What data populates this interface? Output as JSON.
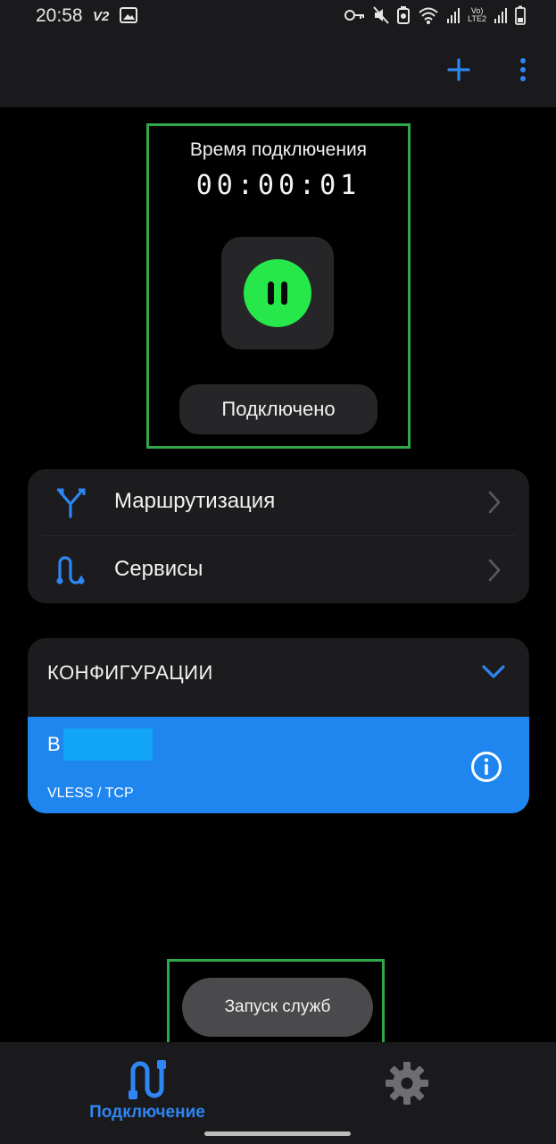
{
  "status_bar": {
    "time": "20:58",
    "app_badge": "V2",
    "network_label_top": "Vo)",
    "network_label_bottom": "LTE2"
  },
  "toolbar": {
    "add_icon": "plus-icon",
    "more_icon": "more-vertical-icon"
  },
  "connection": {
    "title": "Время подключения",
    "timer": "00:00:01",
    "state_label": "Подключено",
    "button_icon": "pause-icon",
    "button_color": "#27e84a"
  },
  "menu": {
    "items": [
      {
        "label": "Маршрутизация",
        "icon": "routing-icon"
      },
      {
        "label": "Сервисы",
        "icon": "services-icon"
      }
    ]
  },
  "configs": {
    "title": "КОНФИГУРАЦИИ",
    "items": [
      {
        "name": "B",
        "protocol": "VLESS / TCP",
        "selected": true
      }
    ]
  },
  "toast": {
    "text": "Запуск служб"
  },
  "bottom_nav": {
    "connect_label": "Подключение",
    "settings_icon": "gear-icon"
  },
  "colors": {
    "accent": "#2e86f2",
    "connected": "#27e84a",
    "highlight_border": "#2fa84a",
    "selected_config": "#1f86f0"
  }
}
